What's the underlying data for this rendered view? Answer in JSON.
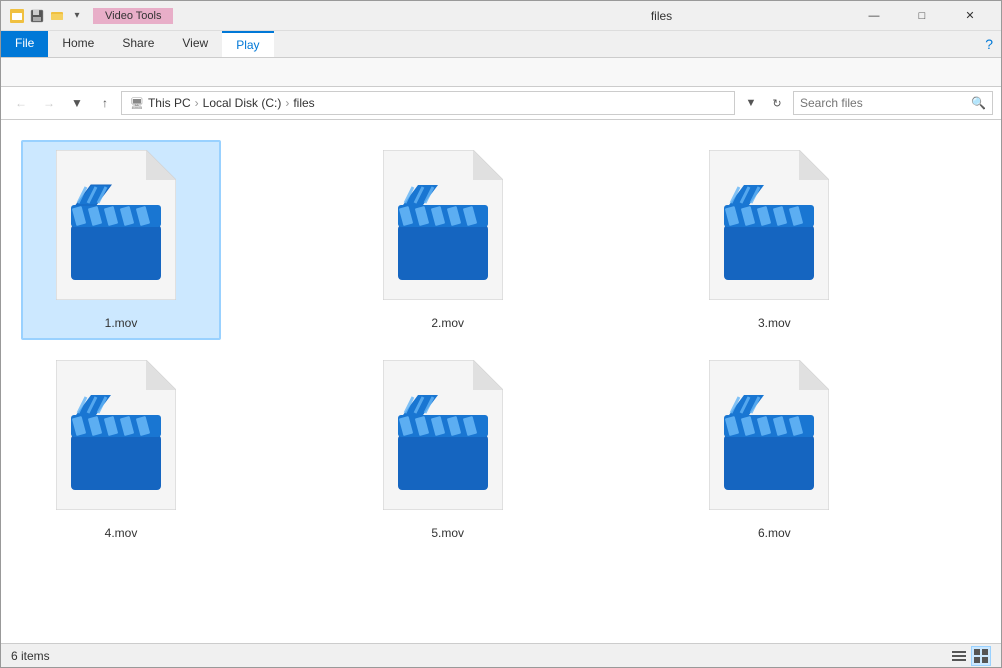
{
  "window": {
    "title": "files",
    "title_bar_label": "files"
  },
  "title_bar": {
    "icons": [
      "quick-access",
      "save",
      "new-folder",
      "undo"
    ],
    "video_tools_label": "Video Tools",
    "window_controls": {
      "minimize": "—",
      "maximize": "□",
      "close": "✕"
    }
  },
  "ribbon": {
    "tabs": [
      {
        "id": "file",
        "label": "File",
        "active": false,
        "file_tab": true
      },
      {
        "id": "home",
        "label": "Home",
        "active": false
      },
      {
        "id": "share",
        "label": "Share",
        "active": false
      },
      {
        "id": "view",
        "label": "View",
        "active": false
      },
      {
        "id": "play",
        "label": "Play",
        "active": true
      }
    ],
    "video_tools_label": "Video Tools"
  },
  "address_bar": {
    "back_btn": "←",
    "forward_btn": "→",
    "up_btn": "↑",
    "path_parts": [
      "This PC",
      "Local Disk (C:)",
      "files"
    ],
    "refresh_btn": "↻",
    "search_placeholder": "Search files",
    "search_label": "Search"
  },
  "files": [
    {
      "id": 1,
      "label": "1.mov",
      "selected": true
    },
    {
      "id": 2,
      "label": "2.mov",
      "selected": false
    },
    {
      "id": 3,
      "label": "3.mov",
      "selected": false
    },
    {
      "id": 4,
      "label": "4.mov",
      "selected": false
    },
    {
      "id": 5,
      "label": "5.mov",
      "selected": false
    },
    {
      "id": 6,
      "label": "6.mov",
      "selected": false
    }
  ],
  "status_bar": {
    "items_count": "6 items",
    "view_list_icon": "≡",
    "view_grid_icon": "⊞"
  },
  "colors": {
    "accent_blue": "#0078d7",
    "movie_blue_dark": "#1a6bbf",
    "movie_blue_light": "#2196f3",
    "video_tools_pink": "#e8aec8",
    "selection_blue": "#cce8ff"
  }
}
